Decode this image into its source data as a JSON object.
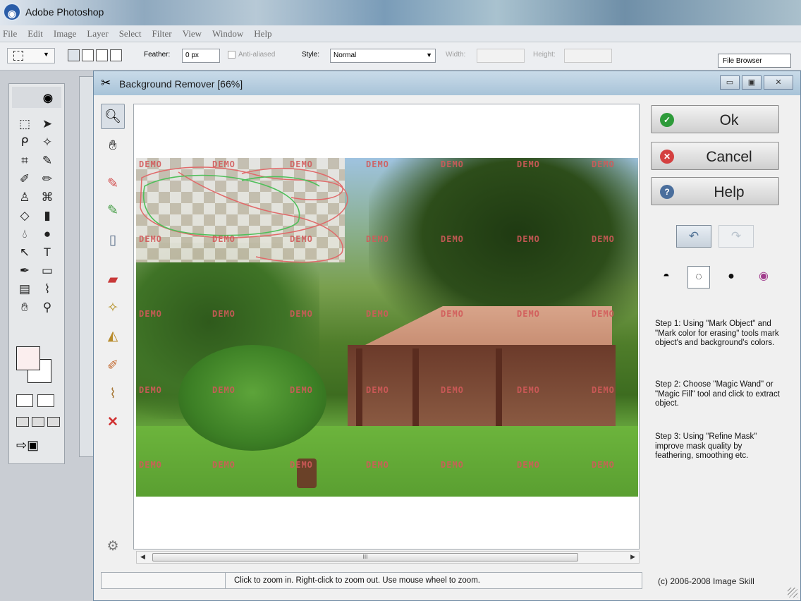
{
  "photoshop": {
    "title": "Adobe Photoshop",
    "menus": [
      "File",
      "Edit",
      "Image",
      "Layer",
      "Select",
      "Filter",
      "View",
      "Window",
      "Help"
    ],
    "options": {
      "feather_label": "Feather:",
      "feather_value": "0 px",
      "antialiased_label": "Anti-aliased",
      "style_label": "Style:",
      "style_value": "Normal",
      "width_label": "Width:",
      "height_label": "Height:",
      "file_browser_tab": "File Browser"
    }
  },
  "dialog": {
    "title": "Background Remover [66%]",
    "window_buttons": {
      "minimize": "▭",
      "maximize": "▣",
      "close": "✕"
    },
    "buttons": {
      "ok": "Ok",
      "cancel": "Cancel",
      "help": "Help"
    },
    "steps": [
      "Step 1: Using \"Mark Object\" and \"Mark color for erasing\" tools mark object's and background's colors.",
      "Step 2: Choose \"Magic Wand\" or \"Magic Fill\" tool and click to extract object.",
      "Step 3: Using \"Refine Mask\" improve mask quality by feathering, smoothing etc."
    ],
    "watermark": "DEMO",
    "status_text": "Click to zoom in. Right-click to zoom out. Use mouse wheel to zoom.",
    "copyright": "(c) 2006-2008 Image Skill",
    "scroll_thumb_glyph": "III"
  },
  "icons": {
    "tools": [
      "zoom-icon",
      "hand-icon",
      "mark-object-icon",
      "mark-erase-icon",
      "new-page-icon",
      "eraser-icon",
      "magic-wand-icon",
      "magic-fill-icon",
      "brush-icon",
      "broom-icon",
      "clear-icon",
      "settings-gear-icon"
    ],
    "colors": {
      "ok": "#2e9b3a",
      "cancel": "#d44040",
      "help": "#4a6e9c",
      "watermark": "#d25a5a"
    }
  }
}
